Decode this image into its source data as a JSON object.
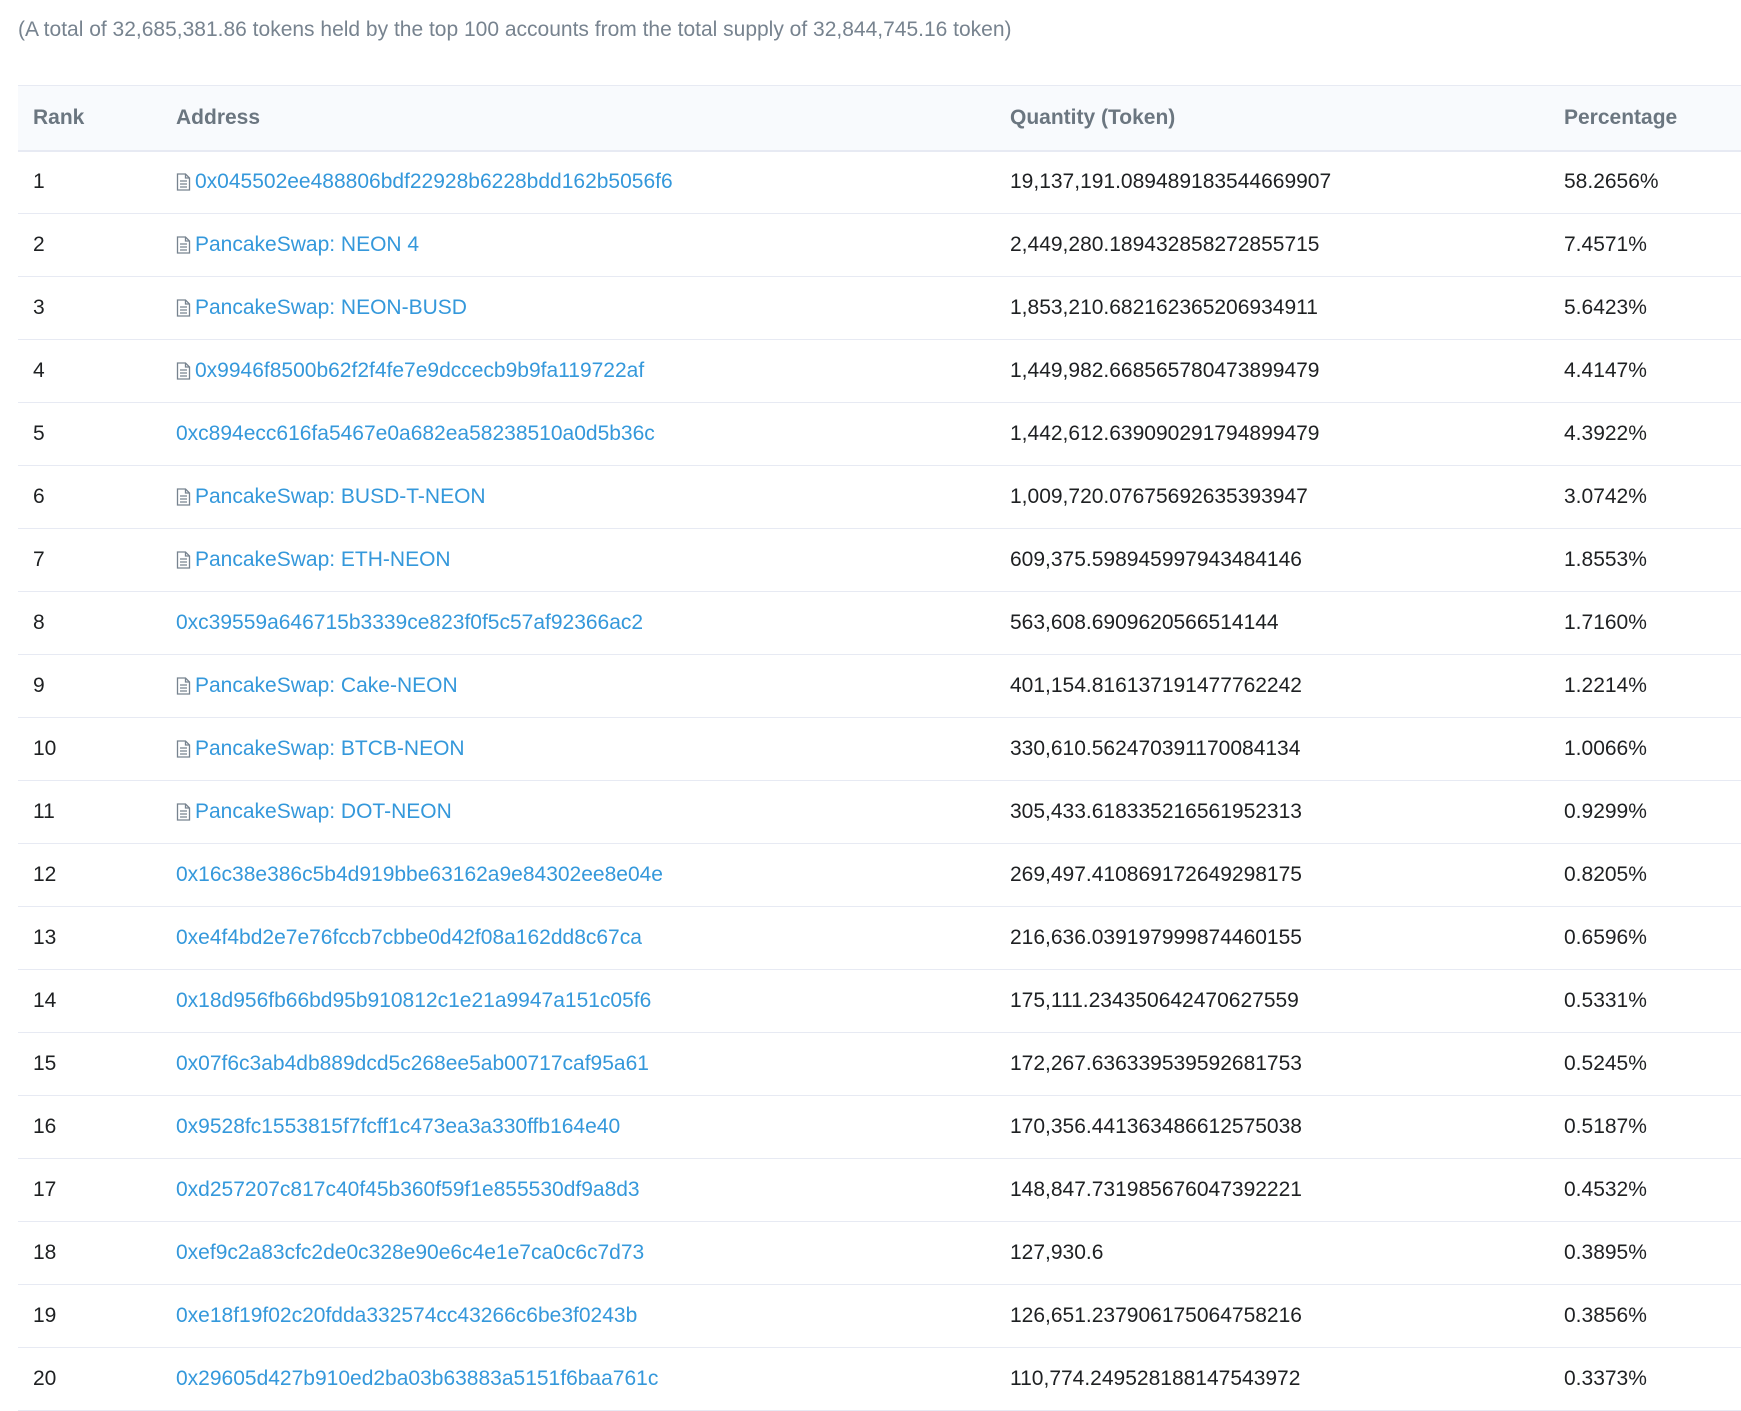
{
  "summary": "(A total of 32,685,381.86 tokens held by the top 100 accounts from the total supply of 32,844,745.16 token)",
  "table": {
    "headers": {
      "rank": "Rank",
      "address": "Address",
      "quantity": "Quantity (Token)",
      "percentage": "Percentage"
    },
    "rows": [
      {
        "rank": "1",
        "address": "0x045502ee488806bdf22928b6228bdd162b5056f6",
        "contract": true,
        "quantity": "19,137,191.089489183544669907",
        "percentage": "58.2656%"
      },
      {
        "rank": "2",
        "address": "PancakeSwap: NEON 4",
        "contract": true,
        "quantity": "2,449,280.189432858272855715",
        "percentage": "7.4571%"
      },
      {
        "rank": "3",
        "address": "PancakeSwap: NEON-BUSD",
        "contract": true,
        "quantity": "1,853,210.682162365206934911",
        "percentage": "5.6423%"
      },
      {
        "rank": "4",
        "address": "0x9946f8500b62f2f4fe7e9dccecb9b9fa119722af",
        "contract": true,
        "quantity": "1,449,982.668565780473899479",
        "percentage": "4.4147%"
      },
      {
        "rank": "5",
        "address": "0xc894ecc616fa5467e0a682ea58238510a0d5b36c",
        "contract": false,
        "quantity": "1,442,612.639090291794899479",
        "percentage": "4.3922%"
      },
      {
        "rank": "6",
        "address": "PancakeSwap: BUSD-T-NEON",
        "contract": true,
        "quantity": "1,009,720.07675692635393947",
        "percentage": "3.0742%"
      },
      {
        "rank": "7",
        "address": "PancakeSwap: ETH-NEON",
        "contract": true,
        "quantity": "609,375.598945997943484146",
        "percentage": "1.8553%"
      },
      {
        "rank": "8",
        "address": "0xc39559a646715b3339ce823f0f5c57af92366ac2",
        "contract": false,
        "quantity": "563,608.6909620566514144",
        "percentage": "1.7160%"
      },
      {
        "rank": "9",
        "address": "PancakeSwap: Cake-NEON",
        "contract": true,
        "quantity": "401,154.816137191477762242",
        "percentage": "1.2214%"
      },
      {
        "rank": "10",
        "address": "PancakeSwap: BTCB-NEON",
        "contract": true,
        "quantity": "330,610.562470391170084134",
        "percentage": "1.0066%"
      },
      {
        "rank": "11",
        "address": "PancakeSwap: DOT-NEON",
        "contract": true,
        "quantity": "305,433.618335216561952313",
        "percentage": "0.9299%"
      },
      {
        "rank": "12",
        "address": "0x16c38e386c5b4d919bbe63162a9e84302ee8e04e",
        "contract": false,
        "quantity": "269,497.410869172649298175",
        "percentage": "0.8205%"
      },
      {
        "rank": "13",
        "address": "0xe4f4bd2e7e76fccb7cbbe0d42f08a162dd8c67ca",
        "contract": false,
        "quantity": "216,636.039197999874460155",
        "percentage": "0.6596%"
      },
      {
        "rank": "14",
        "address": "0x18d956fb66bd95b910812c1e21a9947a151c05f6",
        "contract": false,
        "quantity": "175,111.234350642470627559",
        "percentage": "0.5331%"
      },
      {
        "rank": "15",
        "address": "0x07f6c3ab4db889dcd5c268ee5ab00717caf95a61",
        "contract": false,
        "quantity": "172,267.636339539592681753",
        "percentage": "0.5245%"
      },
      {
        "rank": "16",
        "address": "0x9528fc1553815f7fcff1c473ea3a330ffb164e40",
        "contract": false,
        "quantity": "170,356.441363486612575038",
        "percentage": "0.5187%"
      },
      {
        "rank": "17",
        "address": "0xd257207c817c40f45b360f59f1e855530df9a8d3",
        "contract": false,
        "quantity": "148,847.731985676047392221",
        "percentage": "0.4532%"
      },
      {
        "rank": "18",
        "address": "0xef9c2a83cfc2de0c328e90e6c4e1e7ca0c6c7d73",
        "contract": false,
        "quantity": "127,930.6",
        "percentage": "0.3895%"
      },
      {
        "rank": "19",
        "address": "0xe18f19f02c20fdda332574cc43266c6be3f0243b",
        "contract": false,
        "quantity": "126,651.237906175064758216",
        "percentage": "0.3856%"
      },
      {
        "rank": "20",
        "address": "0x29605d427b910ed2ba03b63883a5151f6baa761c",
        "contract": false,
        "quantity": "110,774.249528188147543972",
        "percentage": "0.3373%"
      }
    ]
  },
  "colors": {
    "link": "#3498db",
    "header_text": "#6b7680",
    "muted_text": "#77838f",
    "border": "#e7eaf3"
  },
  "icons": {
    "contract": "document-icon"
  }
}
